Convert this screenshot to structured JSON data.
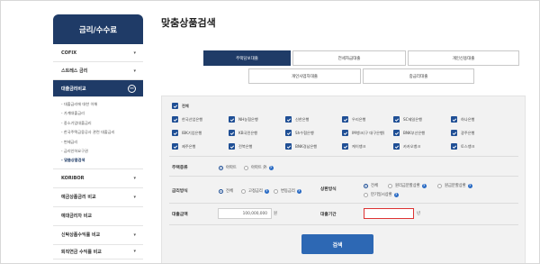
{
  "sidebar": {
    "title": "금리/수수료",
    "items": [
      {
        "label": "COFIX"
      },
      {
        "label": "스트레스 금리"
      },
      {
        "label": "대출금리비교"
      },
      {
        "label": "KORIBOR"
      },
      {
        "label": "예금상품금리 비교"
      },
      {
        "label": "예대금리차 비교"
      },
      {
        "label": "신탁상품수익률 비교"
      },
      {
        "label": "퇴직연금 수익률 비교"
      }
    ],
    "subitems": [
      {
        "label": "- 대출금리에 대한 이해"
      },
      {
        "label": "- 가계대출금리"
      },
      {
        "label": "- 중소기업대출금리"
      },
      {
        "label": "- 한국주택금융공사 관련 대출금리"
      },
      {
        "label": "- 변제금리"
      },
      {
        "label": "- 금리인하요구권"
      },
      {
        "label": "- 맞춤상품검색"
      }
    ]
  },
  "page": {
    "title": "맞춤상품검색"
  },
  "tabs": [
    {
      "label": "주택담보대출"
    },
    {
      "label": "전세자금대출"
    },
    {
      "label": "개인신용대출"
    },
    {
      "label": "개인사업자대출"
    },
    {
      "label": "중금리대출"
    }
  ],
  "banks": {
    "all": "전체",
    "list": [
      "한국산업은행",
      "NH농협은행",
      "신한은행",
      "우리은행",
      "SC제일은행",
      "하나은행",
      "IBK기업은행",
      "KB국민은행",
      "Sh수협은행",
      "IM뱅크(구 대구은행)",
      "BNK부산은행",
      "광주은행",
      "제주은행",
      "전북은행",
      "BNK경남은행",
      "케이뱅크",
      "카카오뱅크",
      "토스뱅크"
    ]
  },
  "housing": {
    "label": "주택종류",
    "options": [
      "아파트",
      "아파트 外"
    ]
  },
  "rate": {
    "label": "금리방식",
    "options": [
      "전체",
      "고정금리",
      "변동금리"
    ]
  },
  "repay": {
    "label": "상환방식",
    "options": [
      "전체",
      "원리금분할상환",
      "원금분할상환",
      "만기일시상환"
    ]
  },
  "loan_amount": {
    "label": "대출금액",
    "value": "100,000,000",
    "unit": "원"
  },
  "loan_period": {
    "label": "대출기간",
    "value": "",
    "unit": "년"
  },
  "search": {
    "label": "검색"
  }
}
